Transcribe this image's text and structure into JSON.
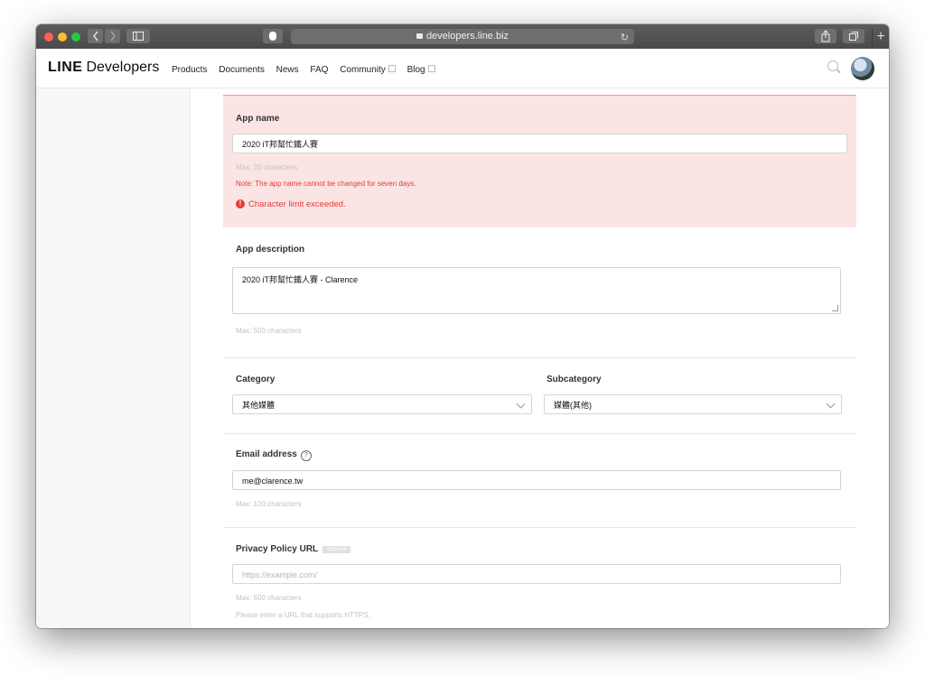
{
  "browser": {
    "url": "developers.line.biz",
    "plus": "+"
  },
  "header": {
    "logo_bold": "LINE",
    "logo_rest": "Developers",
    "nav": [
      "Products",
      "Documents",
      "News",
      "FAQ",
      "Community",
      "Blog"
    ]
  },
  "form": {
    "app_name": {
      "label": "App name",
      "value": "2020 iT邦幫忙鐵人賽",
      "hint": "Max: 20 characters",
      "note": "Note: The app name cannot be changed for seven days.",
      "error": "Character limit exceeded.",
      "error_icon": "!"
    },
    "app_description": {
      "label": "App description",
      "value": "2020 iT邦幫忙鐵人賽 - Clarence",
      "hint": "Max: 500 characters"
    },
    "category": {
      "label": "Category",
      "value": "其他媒體"
    },
    "subcategory": {
      "label": "Subcategory",
      "value": "媒體(其他)"
    },
    "email": {
      "label": "Email address",
      "help_icon": "?",
      "value": "me@clarence.tw",
      "hint": "Max: 100 characters"
    },
    "privacy": {
      "label": "Privacy Policy URL",
      "badge": "optional",
      "placeholder": "https://example.com/",
      "hint": "Max: 500 characters",
      "hint2": "Please enter a URL that supports HTTPS."
    }
  },
  "colors": {
    "error_bg": "#fbe4e4",
    "error_text": "#e23b3b",
    "line_green": "#06c755"
  }
}
